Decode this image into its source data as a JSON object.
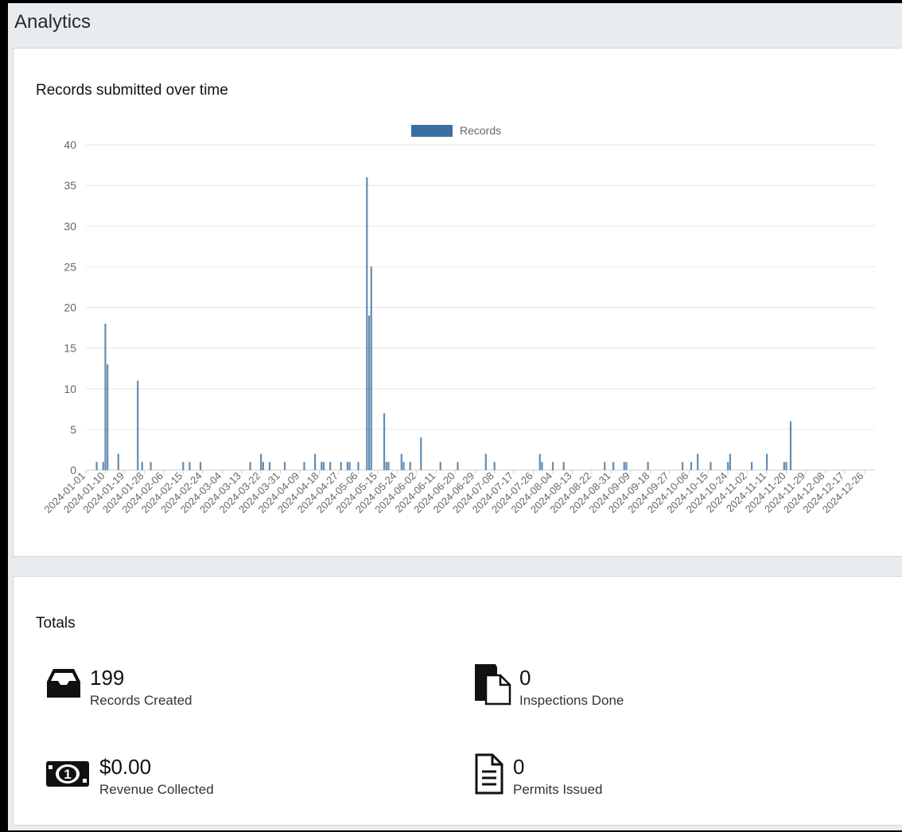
{
  "page": {
    "title": "Analytics"
  },
  "chart_card": {
    "title": "Records submitted over time"
  },
  "chart_data": {
    "type": "bar",
    "title": "Records submitted over time",
    "legend": {
      "position": "top-center",
      "label": "Records"
    },
    "bar_color": "#3b6fa0",
    "grid": true,
    "ylim": [
      0,
      40
    ],
    "yticks": [
      0,
      5,
      10,
      15,
      20,
      25,
      30,
      35,
      40
    ],
    "xlim": [
      "2024-01-01",
      "2024-12-31"
    ],
    "xticks": [
      "2024-01-01",
      "2024-01-10",
      "2024-01-19",
      "2024-01-28",
      "2024-02-06",
      "2024-02-15",
      "2024-02-24",
      "2024-03-04",
      "2024-03-13",
      "2024-03-22",
      "2024-03-31",
      "2024-04-09",
      "2024-04-18",
      "2024-04-27",
      "2024-05-06",
      "2024-05-15",
      "2024-05-24",
      "2024-06-02",
      "2024-06-11",
      "2024-06-20",
      "2024-06-29",
      "2024-07-08",
      "2024-07-17",
      "2024-07-26",
      "2024-08-04",
      "2024-08-13",
      "2024-08-22",
      "2024-08-31",
      "2024-09-09",
      "2024-09-18",
      "2024-09-27",
      "2024-10-06",
      "2024-10-15",
      "2024-10-24",
      "2024-11-02",
      "2024-11-11",
      "2024-11-20",
      "2024-11-29",
      "2024-12-08",
      "2024-12-17",
      "2024-12-26"
    ],
    "series": [
      {
        "name": "Records",
        "points": [
          {
            "x": "2024-01-06",
            "y": 1
          },
          {
            "x": "2024-01-09",
            "y": 1
          },
          {
            "x": "2024-01-10",
            "y": 18
          },
          {
            "x": "2024-01-11",
            "y": 13
          },
          {
            "x": "2024-01-16",
            "y": 2
          },
          {
            "x": "2024-01-25",
            "y": 11
          },
          {
            "x": "2024-01-27",
            "y": 1
          },
          {
            "x": "2024-01-31",
            "y": 1
          },
          {
            "x": "2024-02-15",
            "y": 1
          },
          {
            "x": "2024-02-18",
            "y": 1
          },
          {
            "x": "2024-02-23",
            "y": 1
          },
          {
            "x": "2024-03-17",
            "y": 1
          },
          {
            "x": "2024-03-22",
            "y": 2
          },
          {
            "x": "2024-03-23",
            "y": 1
          },
          {
            "x": "2024-03-26",
            "y": 1
          },
          {
            "x": "2024-04-02",
            "y": 1
          },
          {
            "x": "2024-04-11",
            "y": 1
          },
          {
            "x": "2024-04-16",
            "y": 2
          },
          {
            "x": "2024-04-19",
            "y": 1
          },
          {
            "x": "2024-04-20",
            "y": 1
          },
          {
            "x": "2024-04-23",
            "y": 1
          },
          {
            "x": "2024-04-28",
            "y": 1
          },
          {
            "x": "2024-05-01",
            "y": 1
          },
          {
            "x": "2024-05-02",
            "y": 1
          },
          {
            "x": "2024-05-06",
            "y": 1
          },
          {
            "x": "2024-05-10",
            "y": 36
          },
          {
            "x": "2024-05-11",
            "y": 19
          },
          {
            "x": "2024-05-12",
            "y": 25
          },
          {
            "x": "2024-05-18",
            "y": 7
          },
          {
            "x": "2024-05-19",
            "y": 1
          },
          {
            "x": "2024-05-20",
            "y": 1
          },
          {
            "x": "2024-05-26",
            "y": 2
          },
          {
            "x": "2024-05-27",
            "y": 1
          },
          {
            "x": "2024-05-30",
            "y": 1
          },
          {
            "x": "2024-06-04",
            "y": 4
          },
          {
            "x": "2024-06-13",
            "y": 1
          },
          {
            "x": "2024-06-21",
            "y": 1
          },
          {
            "x": "2024-07-04",
            "y": 2
          },
          {
            "x": "2024-07-08",
            "y": 1
          },
          {
            "x": "2024-07-29",
            "y": 2
          },
          {
            "x": "2024-07-30",
            "y": 1
          },
          {
            "x": "2024-08-04",
            "y": 1
          },
          {
            "x": "2024-08-09",
            "y": 1
          },
          {
            "x": "2024-08-28",
            "y": 1
          },
          {
            "x": "2024-09-01",
            "y": 1
          },
          {
            "x": "2024-09-06",
            "y": 1
          },
          {
            "x": "2024-09-07",
            "y": 1
          },
          {
            "x": "2024-09-17",
            "y": 1
          },
          {
            "x": "2024-10-03",
            "y": 1
          },
          {
            "x": "2024-10-07",
            "y": 1
          },
          {
            "x": "2024-10-10",
            "y": 2
          },
          {
            "x": "2024-10-16",
            "y": 1
          },
          {
            "x": "2024-10-24",
            "y": 1
          },
          {
            "x": "2024-10-25",
            "y": 2
          },
          {
            "x": "2024-11-04",
            "y": 1
          },
          {
            "x": "2024-11-11",
            "y": 2
          },
          {
            "x": "2024-11-19",
            "y": 1
          },
          {
            "x": "2024-11-20",
            "y": 1
          },
          {
            "x": "2024-11-22",
            "y": 6
          }
        ]
      }
    ]
  },
  "totals_card": {
    "title": "Totals",
    "stats": [
      {
        "value": "199",
        "label": "Records Created",
        "icon": "inbox-tray-icon"
      },
      {
        "value": "0",
        "label": "Inspections Done",
        "icon": "documents-stack-icon"
      },
      {
        "value": "$0.00",
        "label": "Revenue Collected",
        "icon": "dollar-bill-icon"
      },
      {
        "value": "0",
        "label": "Permits Issued",
        "icon": "document-lines-icon"
      }
    ]
  }
}
